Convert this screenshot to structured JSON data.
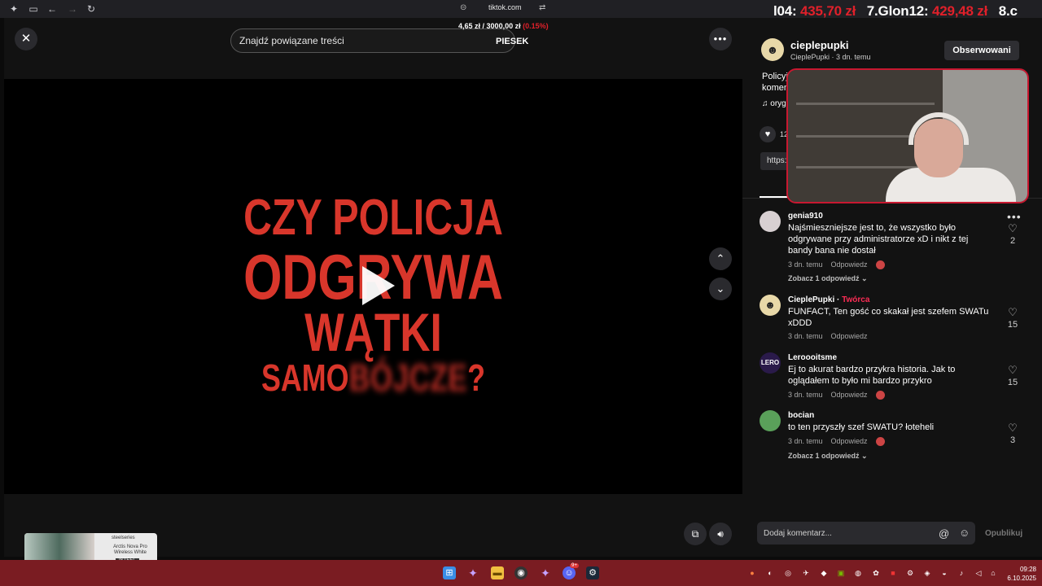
{
  "browser": {
    "url": "tiktok.com"
  },
  "stream_overlay": {
    "rank1_label": "l04:",
    "rank1_value": "435,70 zł",
    "rank2_label": "7.Glon12:",
    "rank2_value": "429,48 zł",
    "rank3_label": "8.c",
    "price_small": "4,65 zł",
    "price_goal": "3000,00 zł",
    "price_pct": "(0.15%)",
    "overlay_word": "PIESEK"
  },
  "search": {
    "placeholder": "Znajdź powiązane treści"
  },
  "video": {
    "line1": "CZY POLICJA",
    "line2": "ODGRYWA",
    "line3": "WĄTKI",
    "line4_start": "SAMO",
    "line4_blur": "BÓJCZE",
    "line4_end": "?"
  },
  "post": {
    "author_name": "cieplepupki",
    "author_sub": "CieplePupki · 3 dn. temu",
    "follow_label": "Obserwowani",
    "desc_line1": "Policyjn",
    "desc_line2": "komen",
    "music": "oryg",
    "like_count": "12",
    "link_chip": "https:"
  },
  "comments": [
    {
      "user": "genia910",
      "text": "Najśmieszniejsze jest to, że wszystko było odgrywane przy administratorze xD i nikt z tej bandy bana nie dostał",
      "time": "3 dn. temu",
      "reply": "Odpowiedz",
      "likes": "2",
      "see_replies": "Zobacz 1 odpowiedź"
    },
    {
      "user": "CieplePupki",
      "badge": "Twórca",
      "text": "FUNFACT, Ten gość co skakał jest szefem SWATu xDDD",
      "time": "3 dn. temu",
      "reply": "Odpowiedz",
      "likes": "15"
    },
    {
      "user": "Leroooitsme",
      "avatar_text": "LERO",
      "text": "Ej to akurat bardzo przykra historia. Jak to oglądałem to było mi bardzo przykro",
      "time": "3 dn. temu",
      "reply": "Odpowiedz",
      "likes": "15"
    },
    {
      "user": "bocian",
      "text": "to ten przyszły szef SWATU? łoteheli",
      "time": "3 dn. temu",
      "reply": "Odpowiedz",
      "likes": "3",
      "see_replies": "Zobacz 1 odpowiedź"
    }
  ],
  "comment_input": {
    "placeholder": "Dodaj komentarz...",
    "publish": "Opublikuj"
  },
  "ad": {
    "brand": "steelseries",
    "product": "Arctis Nova Pro Wireless White",
    "tag": "ISTEEL"
  },
  "taskbar": {
    "time": "09:28",
    "date": "6.10.2025",
    "discord_badge": "9+"
  },
  "icons": {
    "close": "close-icon",
    "more": "more-icon",
    "up": "chevron-up-icon",
    "down": "chevron-down-icon",
    "volume": "volume-icon"
  },
  "colors": {
    "accent_red": "#e0202a",
    "video_text": "#d8362b",
    "creator_badge": "#fe2c55"
  }
}
